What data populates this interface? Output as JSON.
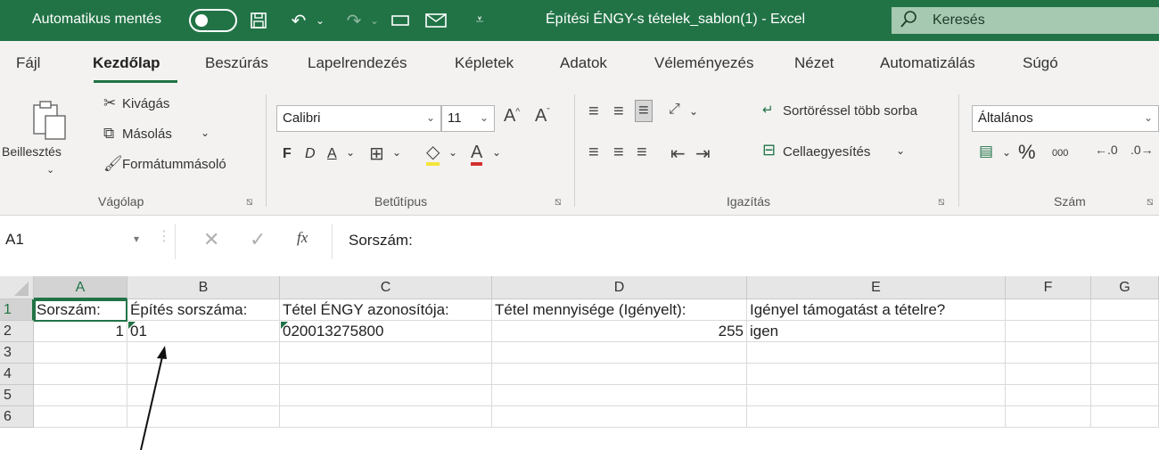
{
  "titlebar": {
    "autosave_label": "Automatikus mentés",
    "file_title": "Építési ÉNGY-s tételek_sablon(1)  -  Excel",
    "search_placeholder": "Keresés"
  },
  "tabs": [
    "Fájl",
    "Kezdőlap",
    "Beszúrás",
    "Lapelrendezés",
    "Képletek",
    "Adatok",
    "Véleményezés",
    "Nézet",
    "Automatizálás",
    "Súgó"
  ],
  "active_tab": "Kezdőlap",
  "ribbon": {
    "clipboard": {
      "paste": "Beillesztés",
      "cut": "Kivágás",
      "copy": "Másolás",
      "format_painter": "Formátummásoló",
      "group": "Vágólap"
    },
    "font": {
      "name": "Calibri",
      "size": "11",
      "bold": "F",
      "italic": "D",
      "underline": "A",
      "group": "Betűtípus"
    },
    "alignment": {
      "wrap_text": "Sortöréssel több sorba",
      "merge": "Cellaegyesítés",
      "group": "Igazítás"
    },
    "number": {
      "format": "Általános",
      "percent": "%",
      "thousands": "000",
      "group": "Szám"
    }
  },
  "formula_bar": {
    "name_box": "A1",
    "fx": "fx",
    "content": "Sorszám:"
  },
  "grid": {
    "columns": [
      "A",
      "B",
      "C",
      "D",
      "E",
      "F",
      "G"
    ],
    "rows": [
      "1",
      "2",
      "3",
      "4",
      "5",
      "6"
    ],
    "row1": [
      "Sorszám:",
      "Építés sorszáma:",
      "Tétel ÉNGY azonosítója:",
      "Tétel mennyisége (Igényelt):",
      "Igényel támogatást a tételre?",
      "",
      ""
    ],
    "row2": [
      "1",
      "01",
      "020013275800",
      "255",
      "igen",
      "",
      ""
    ]
  },
  "colors": {
    "excel_green": "#217346",
    "ribbon_bg": "#f3f2f1"
  }
}
